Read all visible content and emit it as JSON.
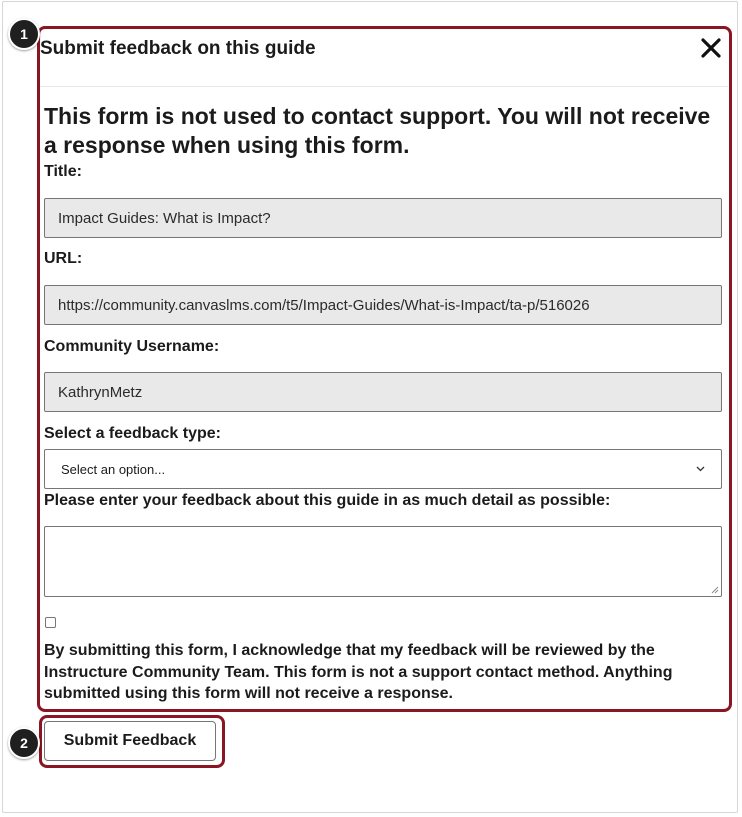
{
  "dialog": {
    "title": "Submit feedback on this guide",
    "warning": "This form is not used to contact support. You will not receive a response when using this form."
  },
  "fields": {
    "title_label": "Title:",
    "title_value": "Impact Guides: What is Impact?",
    "url_label": "URL:",
    "url_value": "https://community.canvaslms.com/t5/Impact-Guides/What-is-Impact/ta-p/516026",
    "username_label": "Community Username:",
    "username_value": "KathrynMetz",
    "type_label": "Select a feedback type:",
    "type_selected": "Select an option...",
    "feedback_label": "Please enter your feedback about this guide in as much detail as possible:",
    "feedback_value": ""
  },
  "acknowledgement": "By submitting this form, I acknowledge that my feedback will be reviewed by the Instructure Community Team. This form is not a support contact method. Anything submitted using this form will not receive a response.",
  "submit_label": "Submit Feedback",
  "callouts": [
    "1",
    "2"
  ],
  "icons": {
    "close": "close-icon",
    "dropdown": "chevron-down-icon"
  },
  "colors": {
    "highlight": "#8a1623",
    "badge": "#1f1f1f",
    "readonly_bg": "#e9e9e9"
  }
}
